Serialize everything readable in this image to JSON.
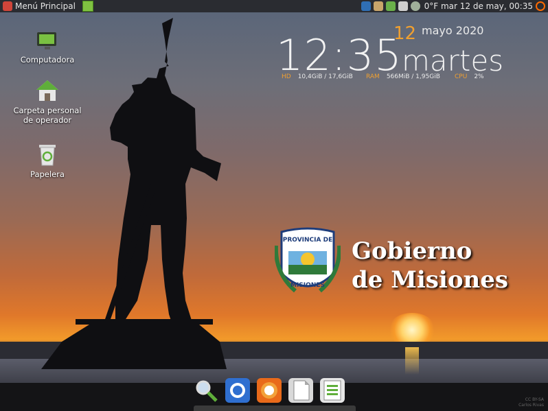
{
  "topbar": {
    "menu_label": "Menú Principal",
    "clock": "0°F mar 12 de may, 00:35",
    "tray_icons": [
      "hp-icon",
      "user-icon",
      "update-icon",
      "network-icon",
      "volume-icon",
      "power-icon"
    ]
  },
  "desktop": {
    "icons": [
      {
        "label": "Computadora",
        "icon": "computer-icon"
      },
      {
        "label": "Carpeta personal de operador",
        "icon": "home-folder-icon"
      },
      {
        "label": "Papelera",
        "icon": "trash-icon"
      }
    ]
  },
  "conky": {
    "time": "12:35",
    "day": "12",
    "month_year": "mayo 2020",
    "weekday": "martes",
    "hd_label": "HD",
    "hd_value": "10,4GiB / 17,6GiB",
    "ram_label": "RAM",
    "ram_value": "566MiB / 1,95GiB",
    "cpu_label": "CPU",
    "cpu_value": "2%"
  },
  "wallpaper": {
    "title_line1": "Gobierno",
    "title_line2": "de Misiones",
    "seal_top": "PROVINCIA DE",
    "seal_bottom": "MISIONES",
    "credit_line1": "CC BY-SA",
    "credit_line2": "Carlos Rivas"
  },
  "dock": {
    "items": [
      "search-icon",
      "thunderbird-icon",
      "firefox-icon",
      "libreoffice-icon",
      "spreadsheet-icon"
    ]
  }
}
